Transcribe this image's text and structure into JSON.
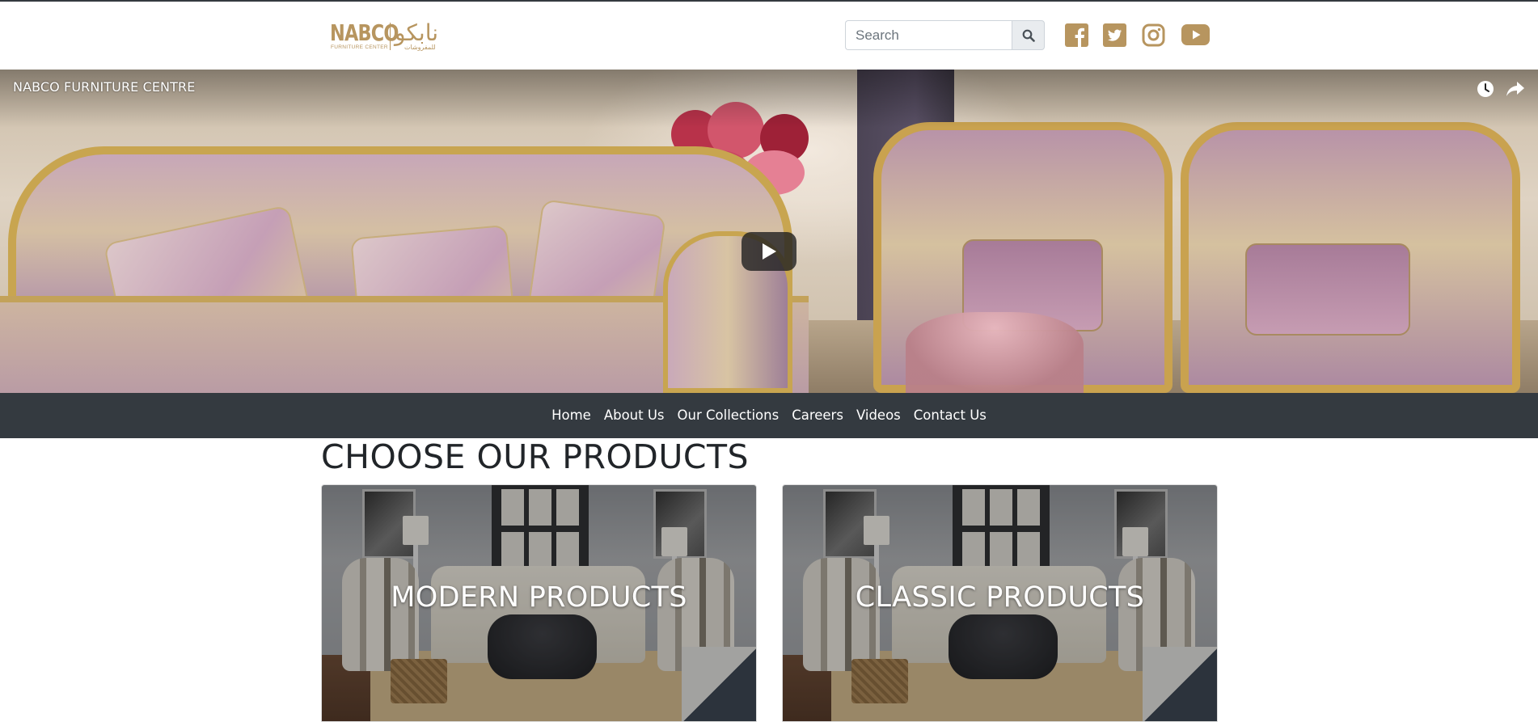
{
  "header": {
    "logo": {
      "latin": "NABCO",
      "subtitle": "FURNITURE CENTER",
      "arabic": "نابكو",
      "arabic_subtitle": "للمفروشات"
    },
    "search": {
      "placeholder": "Search",
      "value": "",
      "button_icon": "search-icon"
    },
    "social": [
      {
        "name": "facebook-icon"
      },
      {
        "name": "twitter-icon"
      },
      {
        "name": "instagram-icon"
      },
      {
        "name": "youtube-icon"
      }
    ],
    "accent_color": "#b7955f"
  },
  "hero": {
    "video_title": "NABCO FURNITURE CENTRE",
    "controls": [
      "watch-later-icon",
      "share-icon",
      "play-icon"
    ]
  },
  "nav": {
    "items": [
      "Home",
      "About Us",
      "Our Collections",
      "Careers",
      "Videos",
      "Contact Us"
    ],
    "background": "#343a40"
  },
  "products": {
    "title": "CHOOSE OUR PRODUCTS",
    "cards": [
      {
        "label": "MODERN PRODUCTS"
      },
      {
        "label": "CLASSIC PRODUCTS"
      }
    ]
  }
}
